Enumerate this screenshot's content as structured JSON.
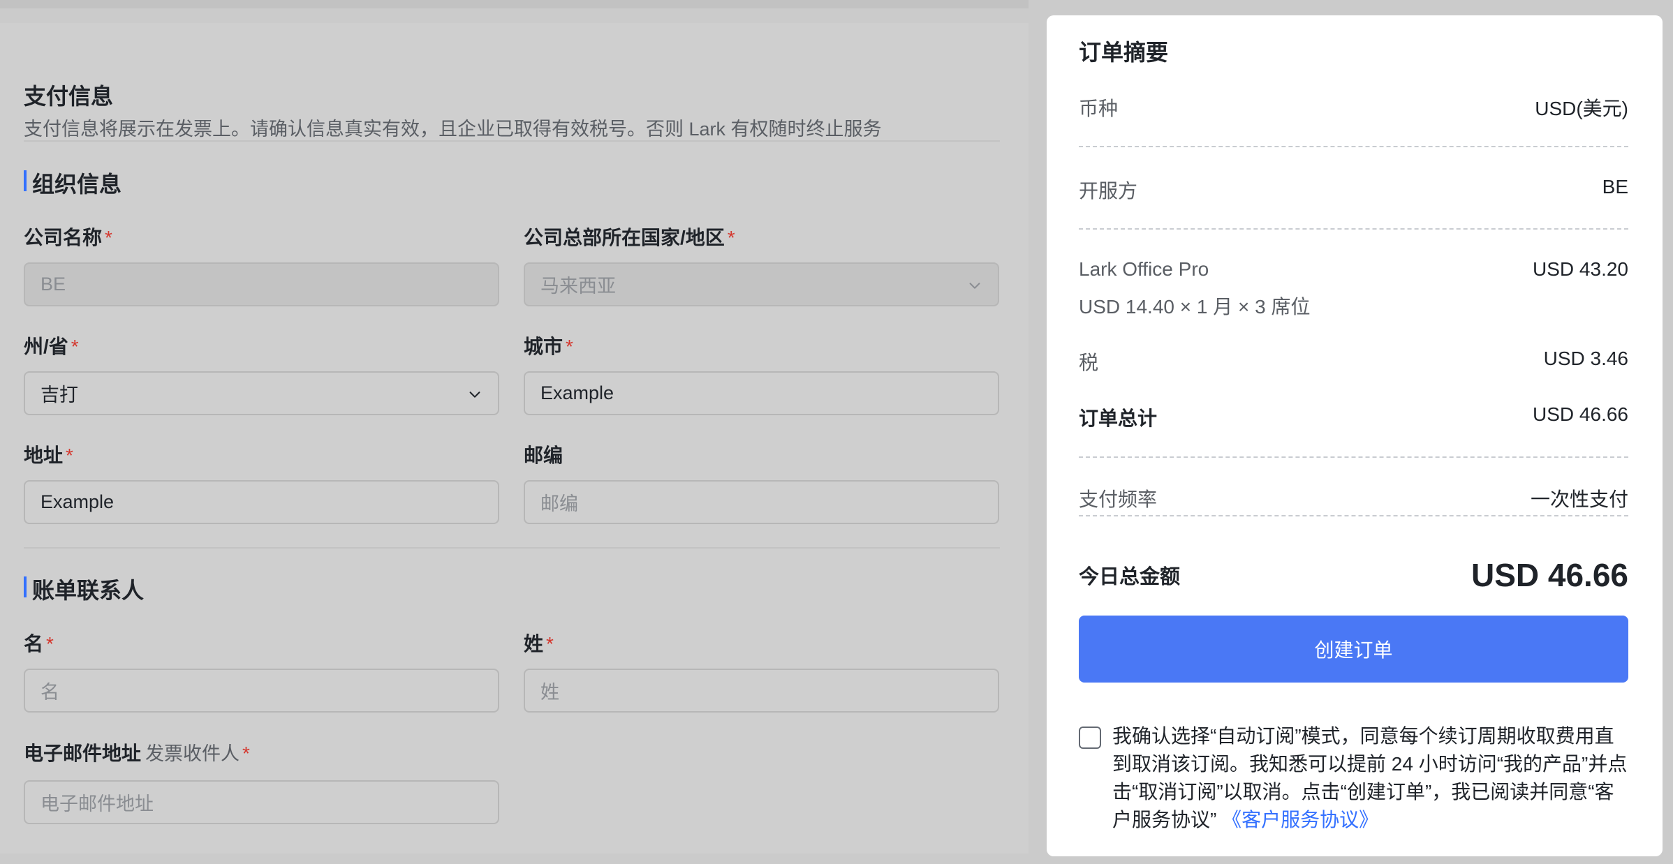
{
  "payment": {
    "title": "支付信息",
    "description": "支付信息将展示在发票上。请确认信息真实有效，且企业已取得有效税号。否则 Lark 有权随时终止服务"
  },
  "org": {
    "title": "组织信息",
    "company_name_label": "公司名称",
    "company_name_value": "BE",
    "hq_label": "公司总部所在国家/地区",
    "hq_value": "马来西亚",
    "state_label": "州/省",
    "state_value": "吉打",
    "city_label": "城市",
    "city_value": "Example",
    "address_label": "地址",
    "address_value": "Example",
    "postal_label": "邮编",
    "postal_placeholder": "邮编"
  },
  "billing": {
    "title": "账单联系人",
    "first_name_label": "名",
    "first_name_placeholder": "名",
    "last_name_label": "姓",
    "last_name_placeholder": "姓",
    "email_label": "电子邮件地址",
    "email_sub": "发票收件人",
    "email_placeholder": "电子邮件地址"
  },
  "required_mark": "*",
  "summary": {
    "title": "订单摘要",
    "currency_label": "币种",
    "currency_value": "USD(美元)",
    "provider_label": "开服方",
    "provider_value": "BE",
    "product_label": "Lark Office Pro",
    "product_value": "USD 43.20",
    "product_detail": "USD 14.40 × 1 月  × 3 席位",
    "tax_label": "税",
    "tax_value": "USD 3.46",
    "order_total_label": "订单总计",
    "order_total_value": "USD 46.66",
    "frequency_label": "支付频率",
    "frequency_value": "一次性支付",
    "today_total_label": "今日总金额",
    "today_total_value": "USD 46.66",
    "create_button": "创建订单",
    "agreement_text": "我确认选择“自动订阅”模式，同意每个续订周期收取费用直到取消该订阅。我知悉可以提前 24 小时访问“我的产品”并点击“取消订阅”以取消。点击“创建订单”，我已阅读并同意“客户服务协议”",
    "agreement_link": "《客户服务协议》"
  },
  "colors": {
    "accent": "#3370ff",
    "button": "#4a78f5",
    "required": "#d4382f",
    "overlay": "#cbcbcb"
  }
}
